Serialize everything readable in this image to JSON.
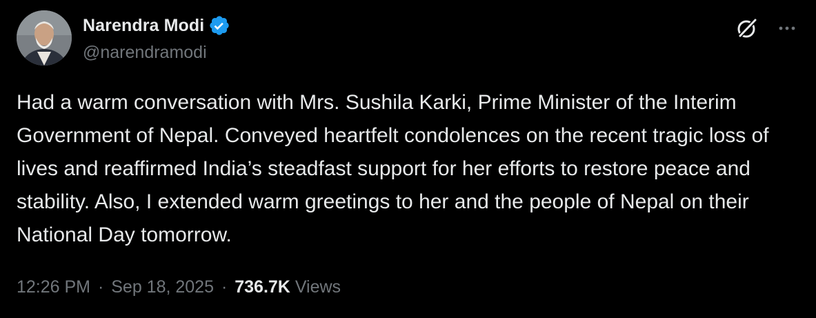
{
  "author": {
    "display_name": "Narendra Modi",
    "handle": "@narendramodi",
    "verified_icon": "verified-badge-icon",
    "avatar_icon": "profile-photo"
  },
  "actions": {
    "grok_icon": "grok-icon",
    "more_icon": "more-options-icon"
  },
  "tweet": {
    "text": "Had a warm conversation with Mrs. Sushila Karki, Prime Minister of the Interim Government of Nepal. Conveyed heartfelt condolences on the recent tragic loss of lives and reaffirmed India’s steadfast support for her efforts to restore peace and stability. Also, I extended warm greetings to her and the people of Nepal on their National Day tomorrow."
  },
  "meta": {
    "time": "12:26 PM",
    "separator": "·",
    "date": "Sep 18, 2025",
    "views_count": "736.7K",
    "views_label": "Views"
  },
  "colors": {
    "background": "#000000",
    "primary_text": "#e7e9ea",
    "secondary_text": "#71767b",
    "verified_blue": "#1d9bf0"
  }
}
